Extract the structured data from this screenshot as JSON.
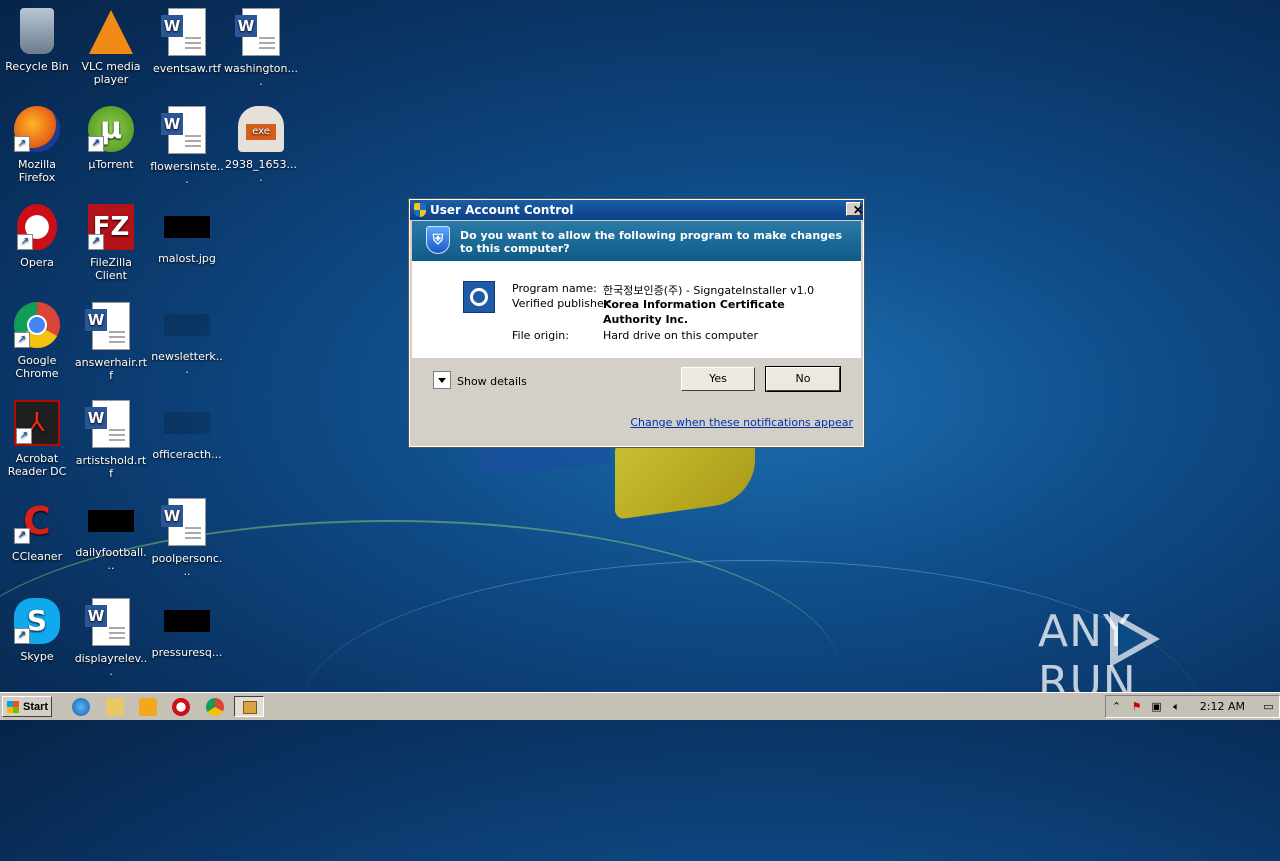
{
  "desktop": {
    "icons": [
      {
        "label": "Recycle Bin",
        "icon": "recycle-bin-icon"
      },
      {
        "label": "VLC media player",
        "icon": "vlc-icon"
      },
      {
        "label": "eventsaw.rtf",
        "icon": "word-document-icon"
      },
      {
        "label": "washington....",
        "icon": "word-document-icon"
      },
      {
        "label": "Mozilla Firefox",
        "icon": "firefox-icon"
      },
      {
        "label": "µTorrent",
        "icon": "utorrent-icon"
      },
      {
        "label": "flowersinste...",
        "icon": "word-document-icon"
      },
      {
        "label": "2938_1653....",
        "icon": "exe-installer-icon"
      },
      {
        "label": "Opera",
        "icon": "opera-icon"
      },
      {
        "label": "FileZilla Client",
        "icon": "filezilla-icon"
      },
      {
        "label": "malost.jpg",
        "icon": "image-thumbnail-icon"
      },
      {
        "label": "Google Chrome",
        "icon": "chrome-icon"
      },
      {
        "label": "answerhair.rtf",
        "icon": "word-document-icon"
      },
      {
        "label": "newsletterk...",
        "icon": "image-thumbnail-icon"
      },
      {
        "label": "Acrobat Reader DC",
        "icon": "acrobat-icon"
      },
      {
        "label": "artistshold.rtf",
        "icon": "word-document-icon"
      },
      {
        "label": "officeracth...",
        "icon": "image-thumbnail-icon"
      },
      {
        "label": "CCleaner",
        "icon": "ccleaner-icon"
      },
      {
        "label": "dailyfootball...",
        "icon": "image-thumbnail-icon"
      },
      {
        "label": "poolpersonc...",
        "icon": "word-document-icon"
      },
      {
        "label": "Skype",
        "icon": "skype-icon"
      },
      {
        "label": "displayrelev...",
        "icon": "word-document-icon"
      },
      {
        "label": "pressuresq...",
        "icon": "image-thumbnail-icon"
      }
    ]
  },
  "uac": {
    "title": "User Account Control",
    "close_label": "✕",
    "question": "Do you want to allow the following program to make changes to this computer?",
    "program_name_label": "Program name:",
    "program_name_value": "한국정보인증(주) - SigngateInstaller v1.0",
    "publisher_label": "Verified publisher:",
    "publisher_value": "Korea Information Certificate Authority Inc.",
    "origin_label": "File origin:",
    "origin_value": "Hard drive on this computer",
    "show_details": "Show details",
    "yes_label": "Yes",
    "no_label": "No",
    "change_link": "Change when these notifications appear"
  },
  "taskbar": {
    "start_label": "Start",
    "clock": "2:12 AM",
    "pinned": [
      "ie-icon",
      "folder-icon",
      "media-player-icon",
      "opera-icon",
      "chrome-icon"
    ]
  },
  "watermark": {
    "left": "ANY",
    "right": "RUN"
  }
}
